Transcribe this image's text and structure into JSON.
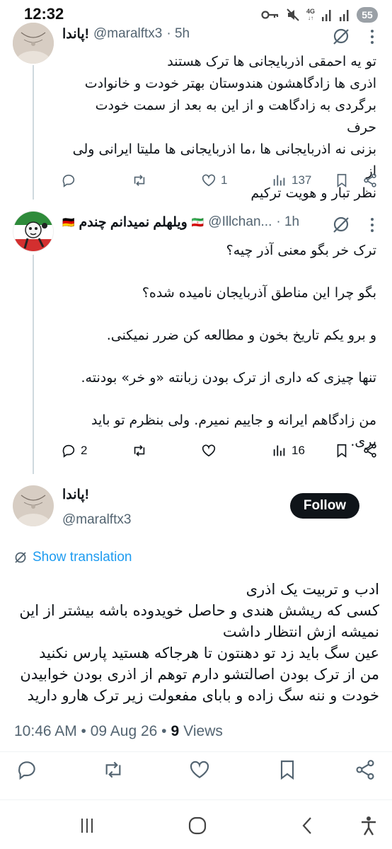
{
  "status": {
    "time": "12:32",
    "network": "4G",
    "battery": "55"
  },
  "tweets": [
    {
      "name": "پاندا!",
      "handle": "@maralftx3",
      "time": "· 5h",
      "text": "تو یه احمقی اذربایجانی ها ترک هستند\nاذری ها زادگاهشون هندوستان بهتر خودت و خانوادت\nبرگردی به زادگاهت و از این به بعد از سمت خودت حرف\nبزنی نه اذربایجانی ها ،ما اذربایجانی ها ملیتا ایرانی ولی از\nنظر تبار و هویت ترکیم",
      "replies": "",
      "reposts": "",
      "likes": "1",
      "views": "137"
    },
    {
      "name": "ویلهلم نمیدانم چندم",
      "flag_left": "🇩🇪",
      "flag_right": "🇮🇷",
      "handle": "@Illchan...",
      "time": "· 1h",
      "text": "ترک خر بگو معنی آذر چیه؟\n\nبگو چرا این مناطق آذربایجان نامیده شده؟\n\nو برو یکم تاریخ بخون و مطالعه کن ضرر نمیکنی.\n\nتنها چیزی که داری از ترک بودن زبانته «و خر» بودنته.\n\nمن زادگاهم ایرانه و جاییم نمیرم. ولی بنظرم تو باید بری.",
      "replies": "2",
      "reposts": "",
      "likes": "",
      "views": "16"
    }
  ],
  "main_tweet": {
    "name": "پاندا!",
    "handle": "@maralftx3",
    "follow_label": "Follow",
    "show_translation": "Show translation",
    "text": "ادب و تربیت یک اذری\nکسی که ریشش هندی و حاصل خویدوده باشه بیشتر از این\nنمیشه ازش انتظار داشت\nعین سگ باید زد تو دهنتون تا هرجاکه هستید پارس نکنید\nمن از ترک بودن اصالتشو دارم توهم از اذری بودن خوابیدن\nخودت و ننه سگ زاده و بابای مفعولت زیر ترک هارو دارید",
    "timestamp": "10:46 AM • 09 Aug 26 •",
    "views_count": "9",
    "views_label": "Views"
  },
  "icons": [
    "reply-icon",
    "repost-icon",
    "like-icon",
    "views-icon",
    "bookmark-icon",
    "share-icon",
    "grok-icon",
    "more-icon",
    "translate-icon"
  ],
  "nav": [
    "recents-icon",
    "home-icon",
    "back-icon",
    "accessibility-icon"
  ]
}
